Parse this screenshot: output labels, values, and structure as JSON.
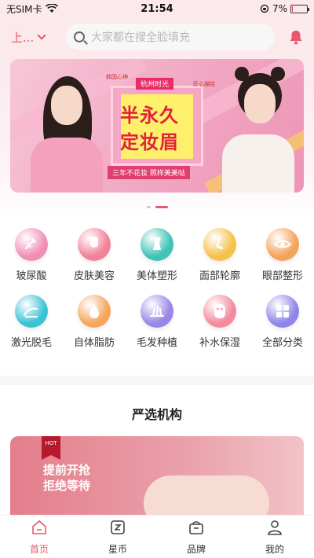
{
  "status_bar": {
    "carrier": "无SIM卡",
    "time": "21:54",
    "battery": "7%",
    "battery_level": 0.07
  },
  "header": {
    "city": "上...",
    "search_placeholder": "大家都在搜全脸填充"
  },
  "banner": {
    "brand": "杭州时光",
    "top_left_tag": "韩国心神",
    "top_right_tag": "匠心描绘",
    "headline_1": "半永久",
    "headline_2": "定妆眉",
    "slogan": "三年不花妆 照样美美哒",
    "active_slide": 1,
    "slide_count": 2
  },
  "categories": [
    {
      "label": "玻尿酸",
      "icon": "syringe-icon",
      "color": "#f08fb6"
    },
    {
      "label": "皮肤美容",
      "icon": "face-icon",
      "color": "#f2829a"
    },
    {
      "label": "美体塑形",
      "icon": "body-icon",
      "color": "#3fc3b5"
    },
    {
      "label": "面部轮廓",
      "icon": "nose-icon",
      "color": "#f6c14a"
    },
    {
      "label": "眼部整形",
      "icon": "eye-icon",
      "color": "#f4a35a"
    },
    {
      "label": "激光脱毛",
      "icon": "laser-icon",
      "color": "#3cc3d3"
    },
    {
      "label": "自体脂肪",
      "icon": "droplet-icon",
      "color": "#f5a65d"
    },
    {
      "label": "毛发种植",
      "icon": "hair-icon",
      "color": "#9a86e8"
    },
    {
      "label": "补水保湿",
      "icon": "mask-icon",
      "color": "#f58a9f"
    },
    {
      "label": "全部分类",
      "icon": "grid-icon",
      "color": "#8f86ea"
    }
  ],
  "section": {
    "title": "严选机构"
  },
  "promo": {
    "badge": "HOT",
    "line1": "提前开抢",
    "line2": "拒绝等待"
  },
  "tabs": [
    {
      "label": "首页",
      "icon": "home-icon",
      "active": true
    },
    {
      "label": "星币",
      "icon": "coin-icon",
      "active": false
    },
    {
      "label": "品牌",
      "icon": "bag-icon",
      "active": false
    },
    {
      "label": "我的",
      "icon": "user-icon",
      "active": false
    }
  ],
  "colors": {
    "accent": "#e8576b",
    "header_bg": "#fbe9ec"
  }
}
